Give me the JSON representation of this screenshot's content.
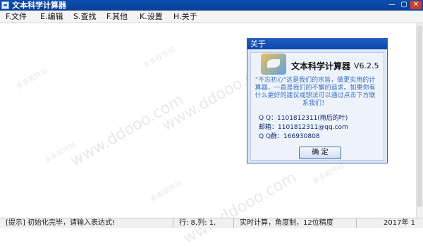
{
  "window": {
    "title": "文本科学计算器",
    "min_glyph": "—",
    "max_glyph": "▢",
    "close_glyph": "✕"
  },
  "menu": {
    "items": [
      {
        "label": "F.文件"
      },
      {
        "label": "E.编辑"
      },
      {
        "label": "S.查找"
      },
      {
        "label": "F.其他"
      },
      {
        "label": "K.设置"
      },
      {
        "label": "H.关于"
      }
    ]
  },
  "watermark": {
    "site": "www.ddooo.com",
    "name": "多多软件站"
  },
  "about": {
    "title": "关于",
    "app_name": "文本科学计算器",
    "version": "V6.2.5",
    "slogan": "\"不忘初心\"这是我们的宗旨，做更实用的计算器，一直是我们的不懈的追求。如果你有什么更好的建议或想法可以通过点击下方联系我们！",
    "qq_label": "Q Q：",
    "qq_value": "1101812311(雨后的叶)",
    "email_label": "邮箱：",
    "email_value": "1101812311@qq.com",
    "group_label": "Q Q群：",
    "group_value": "166930808",
    "ok_label": "确 定"
  },
  "status": {
    "hint": "[提示] 初始化完毕，请输入表达式!",
    "position": "行: 8,列: 1,",
    "mode": "实时计算，角度制，12位精度",
    "date": "2017年 1"
  }
}
